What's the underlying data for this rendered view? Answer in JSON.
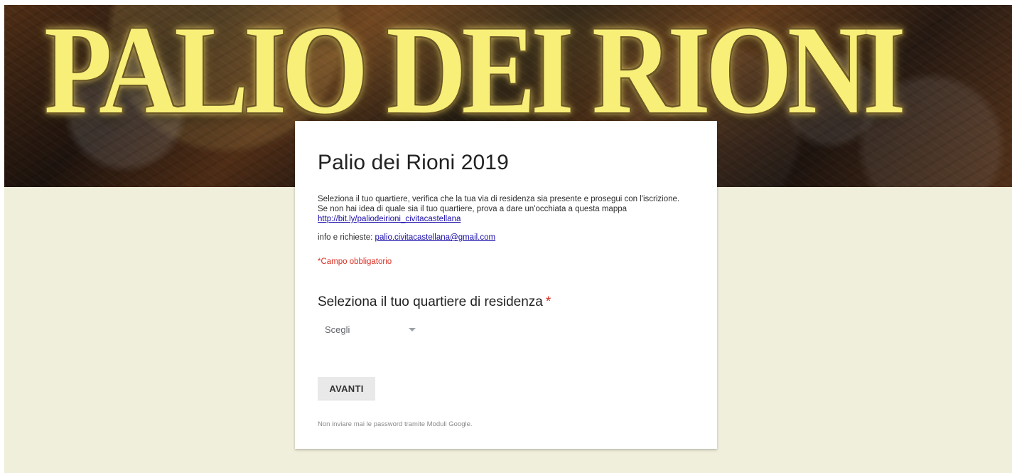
{
  "banner": {
    "title": "PALIO DEI RIONI"
  },
  "form": {
    "title": "Palio dei Rioni 2019",
    "description": {
      "line1": "Seleziona il tuo quartiere, verifica che la tua via di residenza sia presente e prosegui con l'iscrizione.",
      "line2": "Se non hai idea di quale sia il tuo quartiere, prova a dare un'occhiata a questa mappa",
      "link": "http://bit.ly/paliodeirioni_civitacastellana"
    },
    "contact": {
      "prefix": "info e richieste: ",
      "email": "palio.civitacastellana@gmail.com"
    },
    "required_note": "*Campo obbligatorio",
    "question": {
      "label": "Seleziona il tuo quartiere di residenza",
      "required_mark": "*",
      "selected_value": "Scegli"
    },
    "next_label": "AVANTI",
    "footer": "Non inviare mai le password tramite Moduli Google."
  },
  "colors": {
    "page_background": "#f0efdc",
    "card_background": "#ffffff",
    "accent_required": "#d93025",
    "link": "#1a0dab",
    "banner_text": "#f8ef79"
  },
  "icons": {
    "dropdown": "chevron-down-icon"
  }
}
